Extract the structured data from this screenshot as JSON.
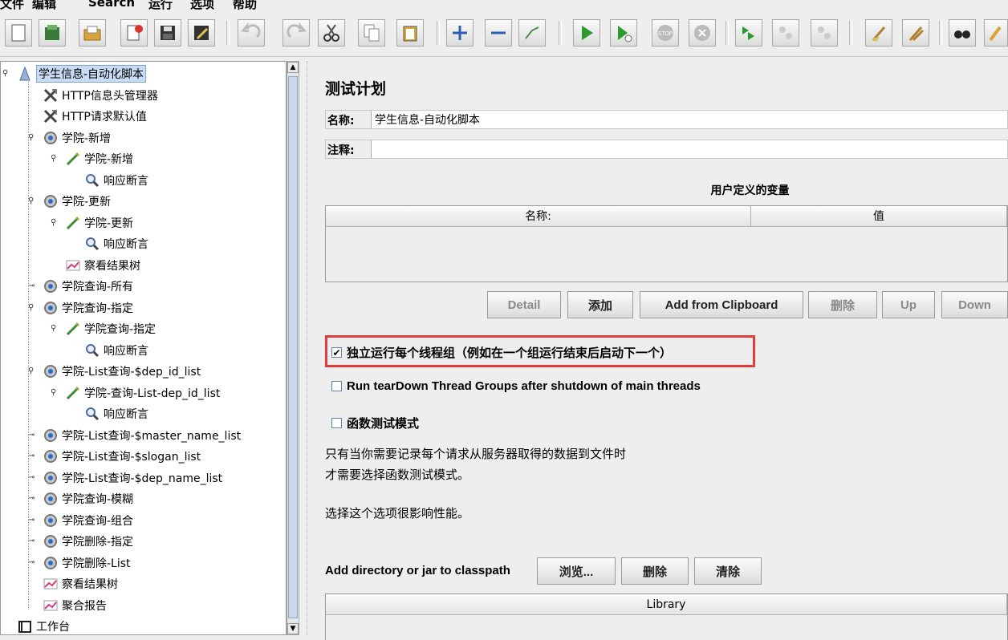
{
  "menu": [
    "文件",
    "编辑",
    "Search",
    "运行",
    "选项",
    "帮助"
  ],
  "toolbar": {
    "icons": [
      "new-icon",
      "templates-icon",
      "open-icon",
      "close-icon",
      "save-icon",
      "save-as-icon",
      "undo-icon",
      "redo-icon",
      "cut-icon",
      "copy-icon",
      "paste-icon",
      "expand-icon",
      "collapse-icon",
      "toggle-icon",
      "start-icon",
      "start-no-pause-icon",
      "stop-icon",
      "shutdown-icon",
      "remote-start-icon",
      "remote-stop-icon",
      "remote-shutdown-icon",
      "clear-icon",
      "clear-all-icon",
      "search-icon",
      "reset-search-icon"
    ]
  },
  "tree": {
    "items": [
      {
        "label": "学生信息-自动化脚本",
        "icon": "test-plan-icon"
      },
      {
        "label": "HTTP信息头管理器",
        "icon": "config-icon"
      },
      {
        "label": "HTTP请求默认值",
        "icon": "config-icon"
      },
      {
        "label": "学院-新增",
        "icon": "thread-group-icon"
      },
      {
        "label": "学院-新增",
        "icon": "sampler-icon"
      },
      {
        "label": "响应断言",
        "icon": "assertion-icon"
      },
      {
        "label": "学院-更新",
        "icon": "thread-group-icon"
      },
      {
        "label": "学院-更新",
        "icon": "sampler-icon"
      },
      {
        "label": "响应断言",
        "icon": "assertion-icon"
      },
      {
        "label": "察看结果树",
        "icon": "listener-icon"
      },
      {
        "label": "学院查询-所有",
        "icon": "thread-group-icon"
      },
      {
        "label": "学院查询-指定",
        "icon": "thread-group-icon"
      },
      {
        "label": "学院查询-指定",
        "icon": "sampler-icon"
      },
      {
        "label": "响应断言",
        "icon": "assertion-icon"
      },
      {
        "label": "学院-List查询-$dep_id_list",
        "icon": "thread-group-icon"
      },
      {
        "label": "学院-查询-List-dep_id_list",
        "icon": "sampler-icon"
      },
      {
        "label": "响应断言",
        "icon": "assertion-icon"
      },
      {
        "label": "学院-List查询-$master_name_list",
        "icon": "thread-group-icon"
      },
      {
        "label": "学院-List查询-$slogan_list",
        "icon": "thread-group-icon"
      },
      {
        "label": "学院-List查询-$dep_name_list",
        "icon": "thread-group-icon"
      },
      {
        "label": "学院查询-模糊",
        "icon": "thread-group-icon"
      },
      {
        "label": "学院查询-组合",
        "icon": "thread-group-icon"
      },
      {
        "label": "学院删除-指定",
        "icon": "thread-group-icon"
      },
      {
        "label": "学院删除-List",
        "icon": "thread-group-icon"
      },
      {
        "label": "察看结果树",
        "icon": "listener-icon"
      },
      {
        "label": "聚合报告",
        "icon": "listener-icon"
      },
      {
        "label": "工作台",
        "icon": "workbench-icon"
      }
    ]
  },
  "panel": {
    "title": "测试计划",
    "name_label": "名称:",
    "name_value": "学生信息-自动化脚本",
    "comment_label": "注释:",
    "comment_value": "",
    "udv_header": "用户定义的变量",
    "udv_columns": [
      "名称:",
      "值"
    ],
    "buttons": {
      "detail": "Detail",
      "add": "添加",
      "add_clipboard": "Add from Clipboard",
      "delete": "删除",
      "up": "Up",
      "down": "Down"
    },
    "options": {
      "serialize": "独立运行每个线程组（例如在一个组运行结束后启动下一个）",
      "serialize_checked": true,
      "teardown": "Run tearDown Thread Groups after shutdown of main threads",
      "teardown_checked": false,
      "functional": "函数测试模式",
      "functional_checked": false
    },
    "functional_note_1": "只有当你需要记录每个请求从服务器取得的数据到文件时",
    "functional_note_2": "才需要选择函数测试模式。",
    "perf_note": "选择这个选项很影响性能。",
    "classpath_label": "Add directory or jar to classpath",
    "classpath_buttons": {
      "browse": "浏览...",
      "delete": "删除",
      "clear": "清除"
    },
    "library_header": "Library"
  }
}
